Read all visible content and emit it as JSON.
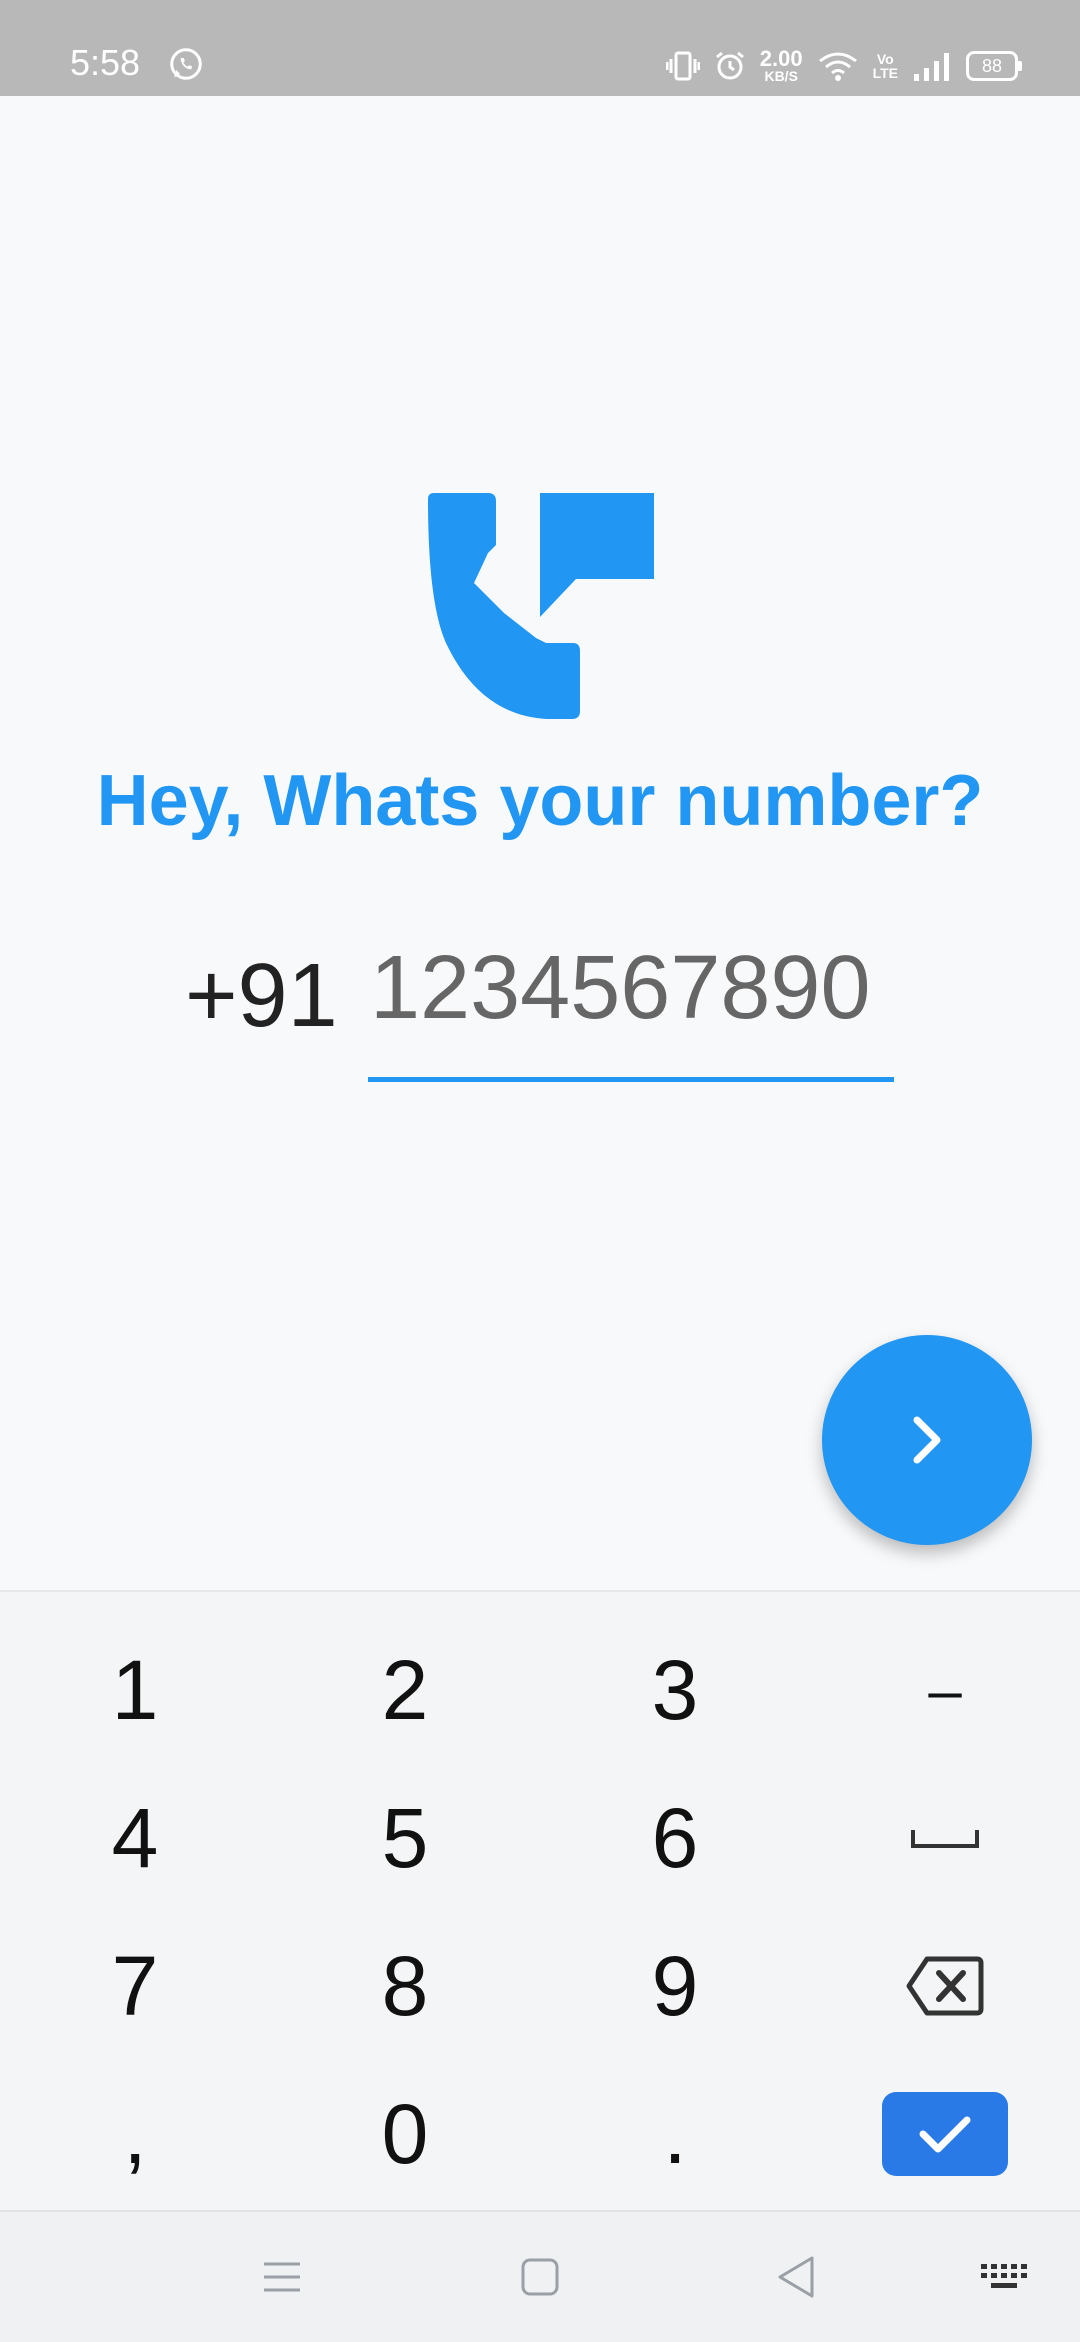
{
  "status_bar": {
    "time": "5:58",
    "speed_value": "2.00",
    "speed_unit": "KB/S",
    "volte_top": "Vo",
    "volte_bottom": "LTE",
    "battery": "88"
  },
  "screen": {
    "title": "Hey, Whats your number?",
    "country_code": "+91",
    "phone_placeholder": "1234567890",
    "accent_color": "#2196f3"
  },
  "icons": {
    "hero": "phone-message-icon",
    "next": "chevron-right-icon"
  },
  "keyboard": {
    "row1": [
      "1",
      "2",
      "3",
      "–"
    ],
    "row2": [
      "4",
      "5",
      "6",
      "space-icon"
    ],
    "row3": [
      "7",
      "8",
      "9",
      "backspace-icon"
    ],
    "row4": [
      ",",
      "0",
      ".",
      "check-icon"
    ]
  },
  "navigation": [
    "menu-icon",
    "home-icon",
    "back-icon",
    "keyboard-icon"
  ]
}
